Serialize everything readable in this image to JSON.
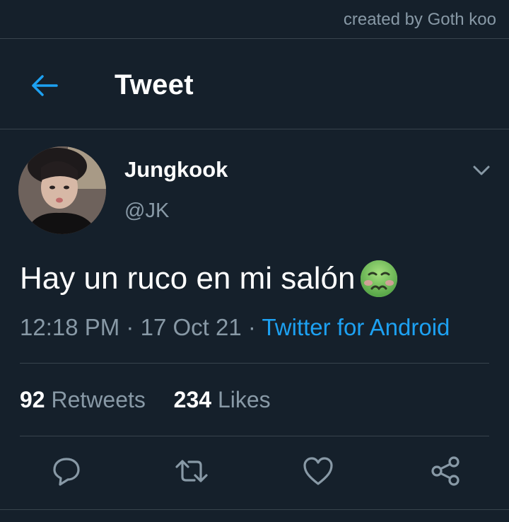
{
  "watermark": "created by Goth koo",
  "header": {
    "title": "Tweet"
  },
  "tweet": {
    "author_name": "Jungkook",
    "author_handle": "@JK",
    "text": "Hay un ruco en mi salón",
    "emoji": "nauseated-face",
    "time": "12:18 PM",
    "date": "17 Oct 21",
    "separator": "·",
    "source": "Twitter for Android"
  },
  "stats": {
    "retweets_count": "92",
    "retweets_label": "Retweets",
    "likes_count": "234",
    "likes_label": "Likes"
  },
  "actions": [
    "reply-icon",
    "retweet-icon",
    "like-icon",
    "share-icon"
  ],
  "colors": {
    "background": "#15202b",
    "divider": "#38444d",
    "secondary_text": "#8899a6",
    "accent": "#1da1f2"
  }
}
